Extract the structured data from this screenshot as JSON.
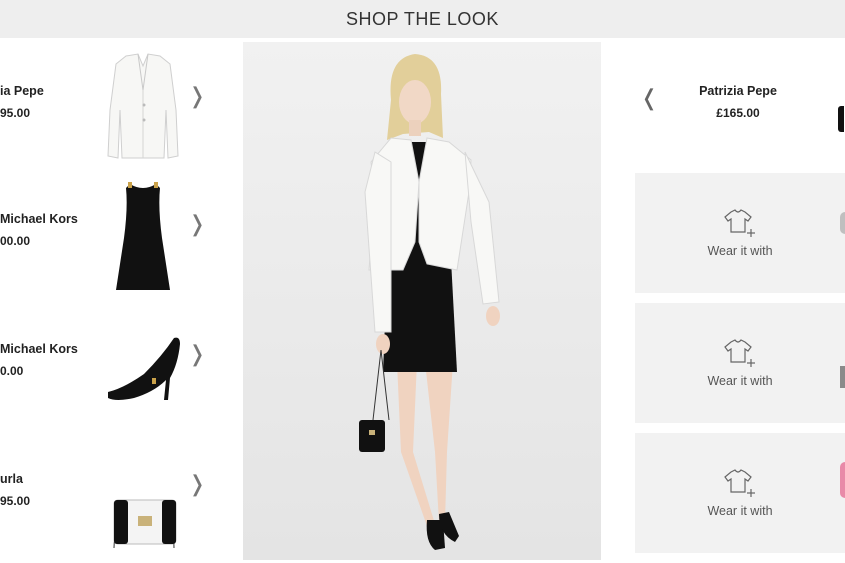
{
  "header": {
    "title": "SHOP THE LOOK"
  },
  "products": [
    {
      "brand": "ia Pepe",
      "price": "95.00",
      "icon": "blazer-thumb"
    },
    {
      "brand": "Michael Kors",
      "price": "00.00",
      "icon": "top-thumb"
    },
    {
      "brand": "Michael Kors",
      "price": "0.00",
      "icon": "heels-thumb"
    },
    {
      "brand": "urla",
      "price": "95.00",
      "icon": "bag-thumb"
    }
  ],
  "featured": {
    "brand": "Patrizia Pepe",
    "price": "£165.00"
  },
  "wear_items": [
    {
      "label": "Wear it with",
      "icon": "tshirt-plus-icon"
    },
    {
      "label": "Wear it with",
      "icon": "tshirt-plus-icon"
    },
    {
      "label": "Wear it with",
      "icon": "tshirt-plus-icon"
    }
  ],
  "colors": {
    "header_bg": "#eeeeee",
    "panel_bg": "#f2f2f2",
    "accent_pink": "#e88aa8"
  }
}
